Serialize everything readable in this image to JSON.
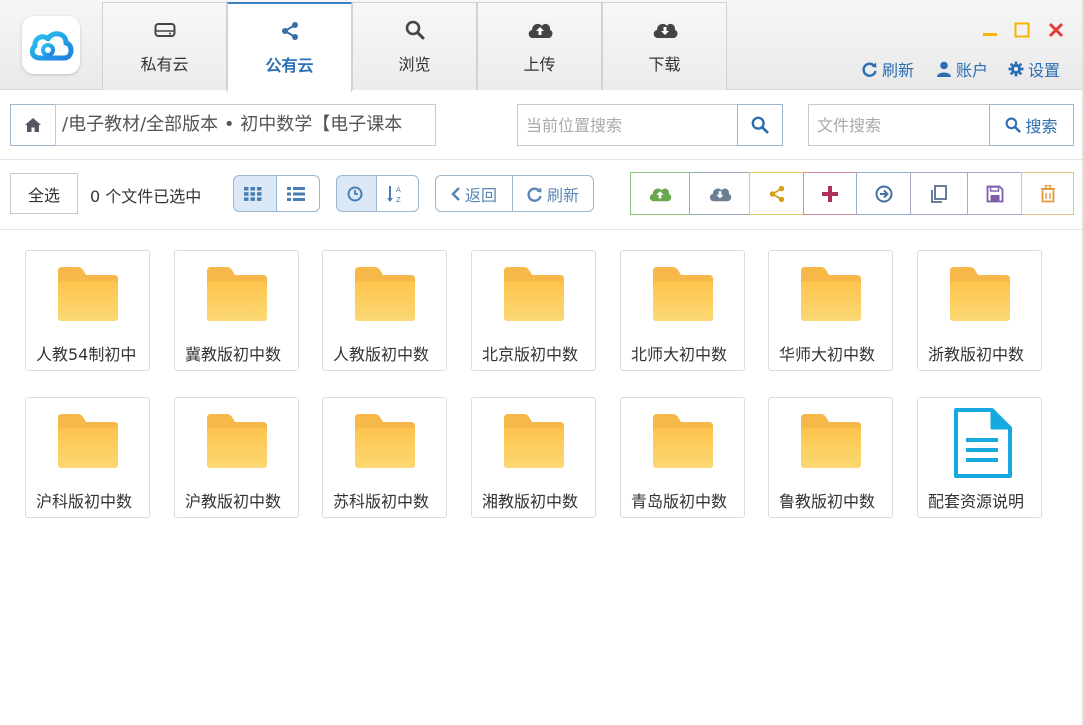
{
  "tabs": [
    {
      "label": "私有云",
      "icon": "hard-drive-icon"
    },
    {
      "label": "公有云",
      "icon": "share-icon",
      "active": true
    },
    {
      "label": "浏览",
      "icon": "search-icon"
    },
    {
      "label": "上传",
      "icon": "cloud-upload-icon"
    },
    {
      "label": "下载",
      "icon": "cloud-download-icon"
    }
  ],
  "header": {
    "refresh_label": "刷新",
    "account_label": "账户",
    "settings_label": "设置",
    "colors": {
      "minimize": "#f5b400",
      "maximize": "#f5b400",
      "close": "#e53935",
      "accent": "#2a6db0"
    }
  },
  "path": {
    "text": "/电子教材/全部版本 • 初中数学【电子课本"
  },
  "search": {
    "location_placeholder": "当前位置搜索",
    "file_placeholder": "文件搜索",
    "search_button_label": "搜索"
  },
  "toolbar": {
    "select_all_label": "全选",
    "selection_status": "0 个文件已选中",
    "back_label": "返回",
    "refresh_label": "刷新",
    "actions": [
      {
        "name": "upload-action-button",
        "icon": "cloud-upload-icon",
        "color": "#6aa84f"
      },
      {
        "name": "download-action-button",
        "icon": "cloud-download-icon",
        "color": "#6b7f93"
      },
      {
        "name": "share-action-button",
        "icon": "share-icon",
        "color": "#d4a017"
      },
      {
        "name": "new-action-button",
        "icon": "plus-icon",
        "color": "#c2185b"
      },
      {
        "name": "move-action-button",
        "icon": "arrow-circle-right-icon",
        "color": "#4a6fa5"
      },
      {
        "name": "copy-action-button",
        "icon": "copy-icon",
        "color": "#5a6b8c"
      },
      {
        "name": "save-action-button",
        "icon": "floppy-disk-icon",
        "color": "#7b5ea7"
      },
      {
        "name": "delete-action-button",
        "icon": "trash-icon",
        "color": "#e39a3a"
      }
    ]
  },
  "files": [
    {
      "name": "人教54制初中",
      "type": "folder"
    },
    {
      "name": "冀教版初中数",
      "type": "folder"
    },
    {
      "name": "人教版初中数",
      "type": "folder"
    },
    {
      "name": "北京版初中数",
      "type": "folder"
    },
    {
      "name": "北师大初中数",
      "type": "folder"
    },
    {
      "name": "华师大初中数",
      "type": "folder"
    },
    {
      "name": "浙教版初中数",
      "type": "folder"
    },
    {
      "name": "沪科版初中数",
      "type": "folder"
    },
    {
      "name": "沪教版初中数",
      "type": "folder"
    },
    {
      "name": "苏科版初中数",
      "type": "folder"
    },
    {
      "name": "湘教版初中数",
      "type": "folder"
    },
    {
      "name": "青岛版初中数",
      "type": "folder"
    },
    {
      "name": "鲁教版初中数",
      "type": "folder"
    },
    {
      "name": "配套资源说明",
      "type": "document"
    }
  ]
}
